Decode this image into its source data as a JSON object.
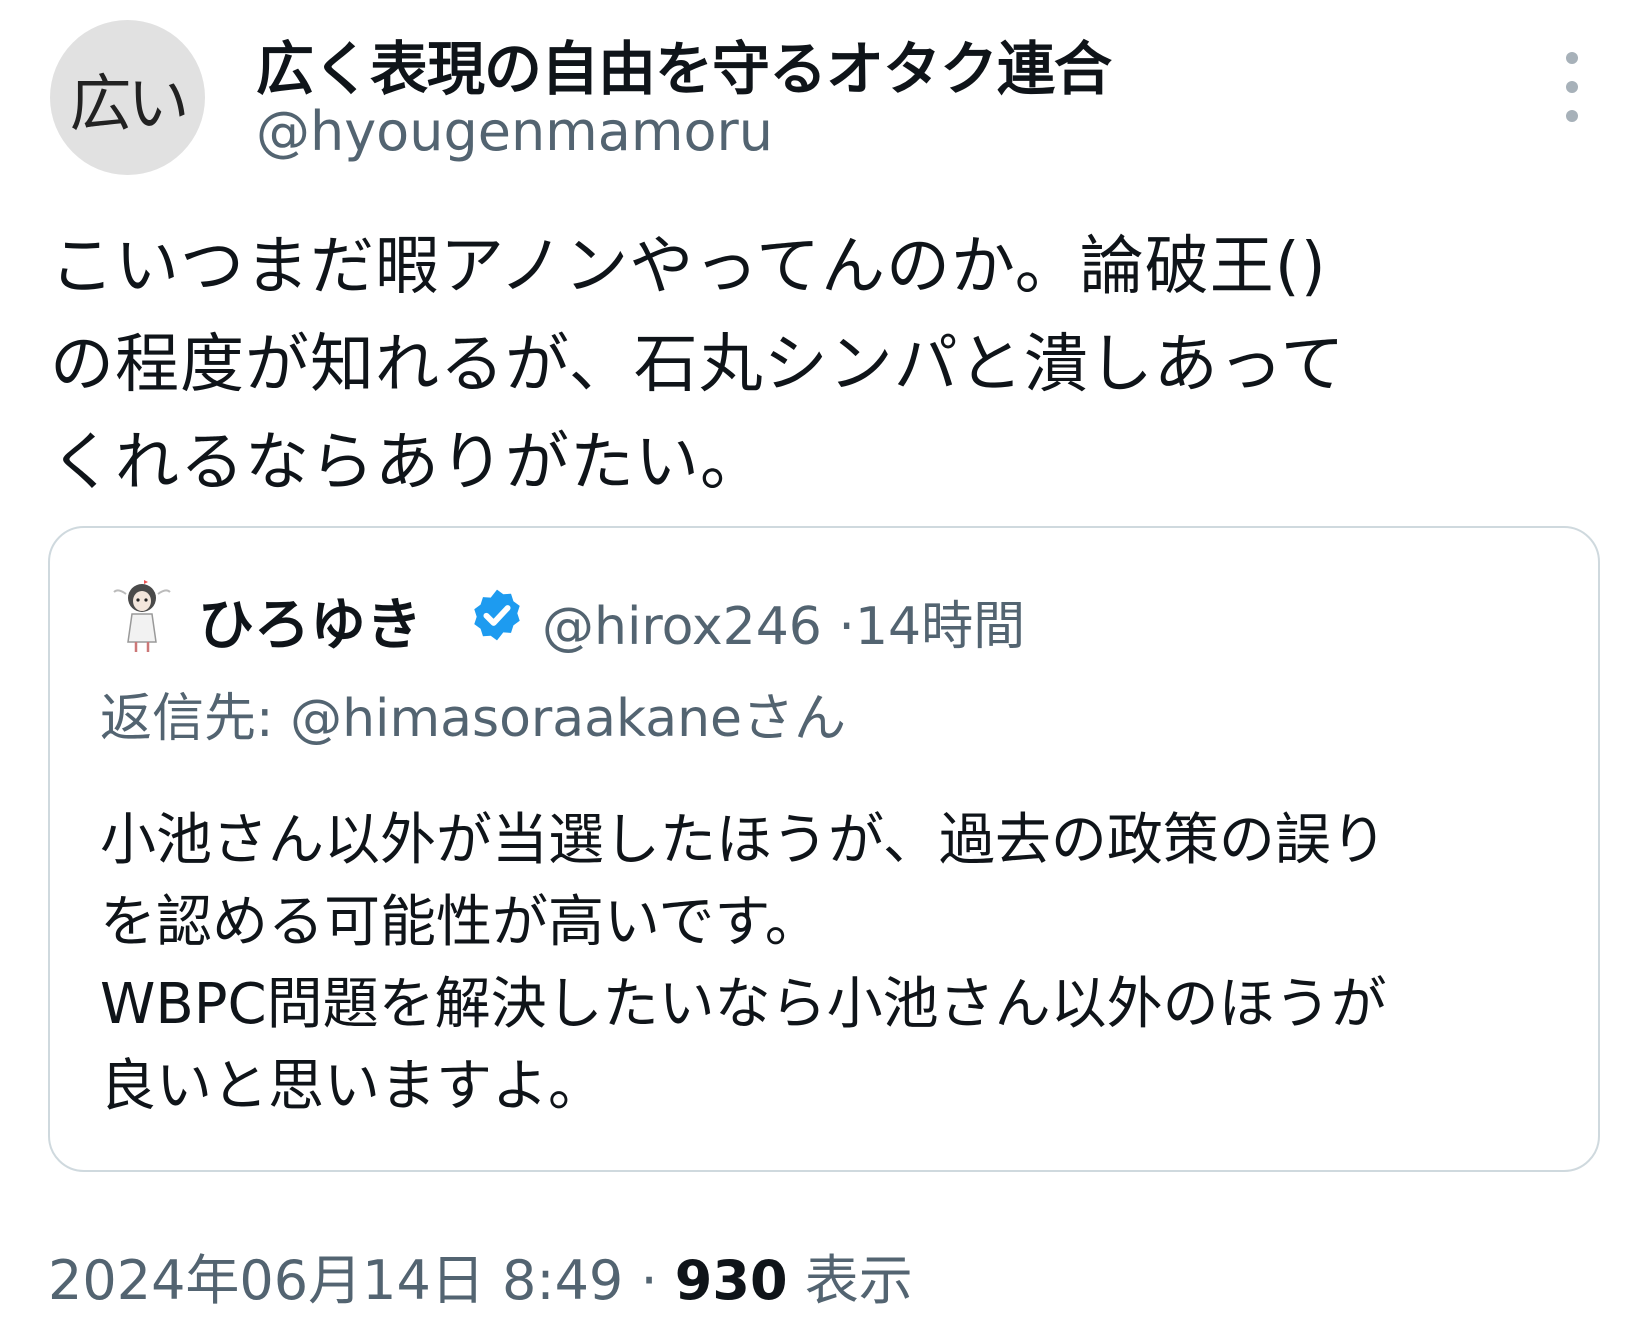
{
  "author": {
    "avatar_text": "広い",
    "display_name": "広く表現の自由を守るオタク連合",
    "handle": "@hyougenmamoru"
  },
  "tweet": {
    "text": "こいつまだ暇アノンやってんのか。論破王()\nの程度が知れるが、石丸シンパと潰しあって\nくれるならありがたい。"
  },
  "quote": {
    "author_name": "ひろゆき",
    "verified_icon": "verified-badge-icon",
    "handle": "@hirox246",
    "separator": "·",
    "time": "14時間",
    "reply_label": "返信先:",
    "reply_target": "@himasoraakaneさん",
    "text": "小池さん以外が当選したほうが、過去の政策の誤り\nを認める可能性が高いです。\nWBPC問題を解決したいなら小池さん以外のほうが\n良いと思いますよ。"
  },
  "footer": {
    "timestamp": "2024年06月14日 8:49",
    "separator": "·",
    "view_count": "930",
    "view_label": "表示"
  },
  "colors": {
    "text_primary": "#0f1419",
    "text_secondary": "#536471",
    "border": "#cfd9de",
    "verified": "#1d9bf0",
    "avatar_bg": "#e1e1e1"
  }
}
